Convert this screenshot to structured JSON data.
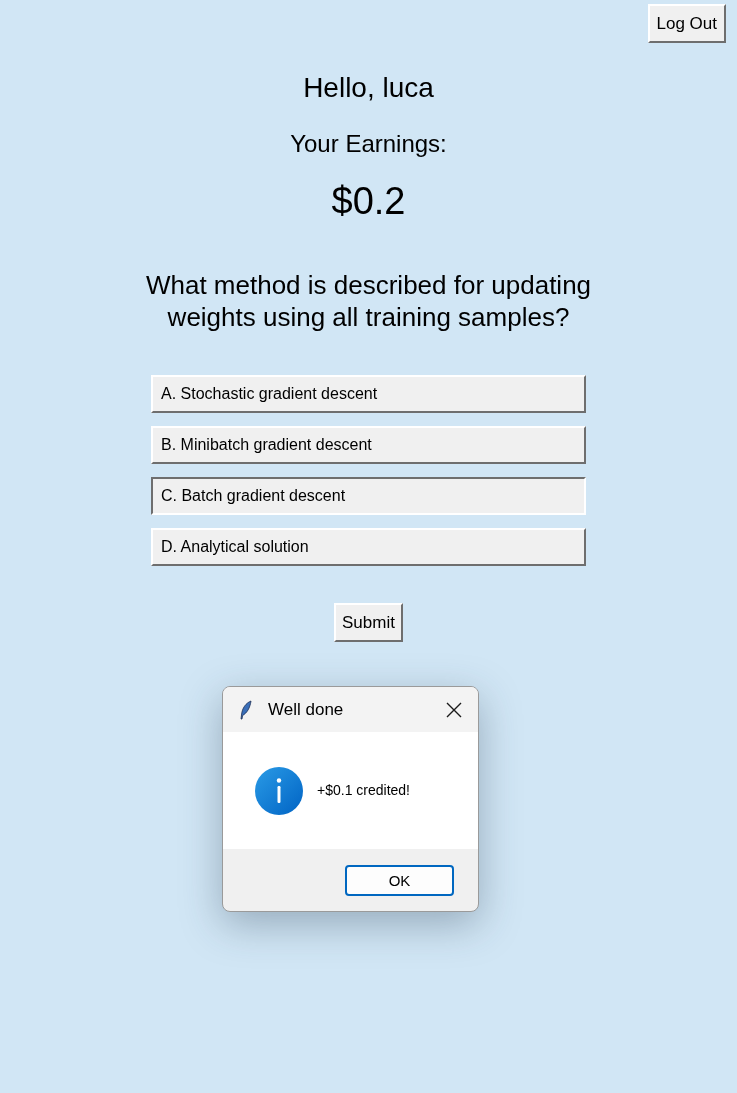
{
  "header": {
    "logout_button": "Log Out"
  },
  "greeting": "Hello, luca",
  "earnings": {
    "label": "Your Earnings:",
    "amount": "$0.2"
  },
  "question": {
    "text": "What method is described for updating weights using all training samples?",
    "options": [
      {
        "label": "A. Stochastic gradient descent",
        "selected": false
      },
      {
        "label": "B. Minibatch gradient descent",
        "selected": false
      },
      {
        "label": "C. Batch gradient descent",
        "selected": true
      },
      {
        "label": "D. Analytical solution",
        "selected": false
      }
    ]
  },
  "submit_button": "Submit",
  "dialog": {
    "title": "Well done",
    "message": "+$0.1 credited!",
    "buttons": [
      "OK"
    ]
  }
}
